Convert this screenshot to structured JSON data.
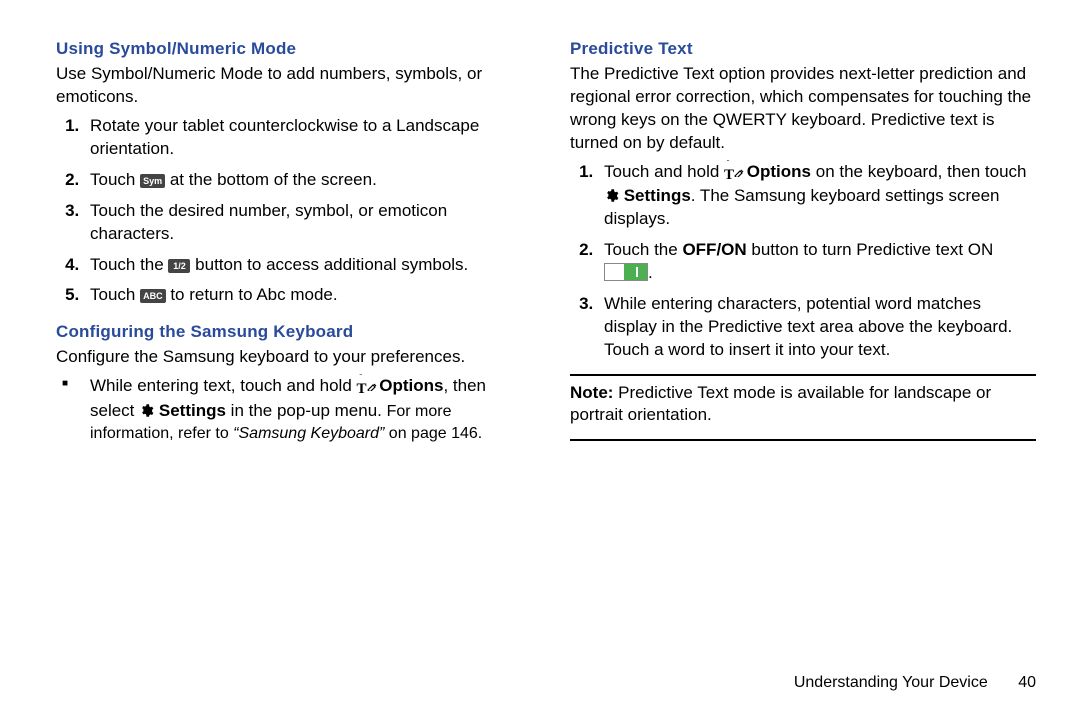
{
  "left": {
    "sym_heading": "Using Symbol/Numeric Mode",
    "sym_intro": "Use Symbol/Numeric Mode to add numbers, symbols, or emoticons.",
    "sym_steps": {
      "s1": "Rotate your tablet counterclockwise to a Landscape orientation.",
      "s2a": "Touch ",
      "s2_key": "Sym",
      "s2b": " at the bottom of the screen.",
      "s3": "Touch the desired number, symbol, or emoticon characters.",
      "s4a": "Touch the ",
      "s4_key": "1/2",
      "s4b": " button to access additional symbols.",
      "s5a": "Touch ",
      "s5_key": "ABC",
      "s5b": " to return to Abc mode."
    },
    "cfg_heading": "Configuring the Samsung Keyboard",
    "cfg_intro": "Configure the Samsung keyboard to your preferences.",
    "cfg_bullet": {
      "a": "While entering text, touch and hold ",
      "opt": " Options",
      "b": ", then select ",
      "set": " Settings",
      "c": " in the pop-up menu. ",
      "more1": "For more information, refer to ",
      "ref": "“Samsung Keyboard”",
      "more2": " on page 146."
    }
  },
  "right": {
    "pt_heading": "Predictive Text",
    "pt_intro": "The Predictive Text option provides next-letter prediction and regional error correction, which compensates for touching the wrong keys on the QWERTY keyboard. Predictive text is turned on by default.",
    "pt_steps": {
      "s1a": "Touch and hold ",
      "s1_opt": " Options",
      "s1b": " on the keyboard, then touch ",
      "s1_set": " Settings",
      "s1c": ". The Samsung keyboard settings screen displays.",
      "s2a": "Touch the ",
      "s2_btn": "OFF/ON",
      "s2b": " button to turn Predictive text ON ",
      "s2c": ".",
      "s3": "While entering characters, potential word matches display in the Predictive text area above the keyboard. Touch a word to insert it into your text."
    },
    "note_label": "Note:",
    "note_body": " Predictive Text mode is available for landscape or portrait orientation."
  },
  "footer": {
    "section": "Understanding Your Device",
    "page": "40"
  }
}
